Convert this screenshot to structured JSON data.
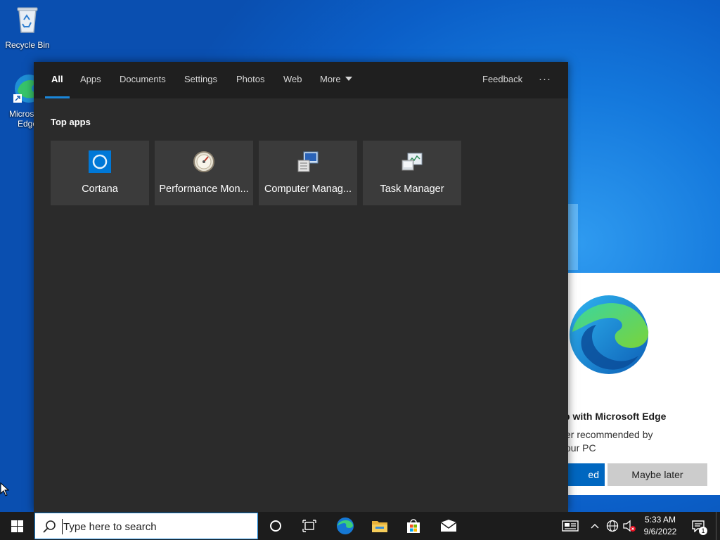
{
  "desktop": {
    "recycle_bin_label": "Recycle Bin",
    "edge_label_line1": "Micros",
    "edge_label_line2": "Edge"
  },
  "search_panel": {
    "tabs": [
      {
        "label": "All",
        "active": true
      },
      {
        "label": "Apps"
      },
      {
        "label": "Documents"
      },
      {
        "label": "Settings"
      },
      {
        "label": "Photos"
      },
      {
        "label": "Web"
      },
      {
        "label": "More"
      }
    ],
    "feedback_label": "Feedback",
    "more_options_label": "···",
    "section_title": "Top apps",
    "top_apps": [
      {
        "label": "Cortana",
        "icon": "cortana-icon"
      },
      {
        "label": "Performance Mon...",
        "icon": "performance-monitor-icon"
      },
      {
        "label": "Computer Manag...",
        "icon": "computer-management-icon"
      },
      {
        "label": "Task Manager",
        "icon": "task-manager-icon"
      }
    ]
  },
  "edge_promo": {
    "title": "b with Microsoft Edge",
    "desc_line1": "er recommended by",
    "desc_line2": "our PC",
    "primary_label": "ed",
    "secondary_label": "Maybe later"
  },
  "taskbar": {
    "search_placeholder": "Type here to search",
    "time": "5:33 AM",
    "date": "9/6/2022",
    "notification_count": "1"
  },
  "colors": {
    "accent": "#1a86d9",
    "panel_bg": "#2b2b2b",
    "tile_bg": "#3b3b3b",
    "taskbar_bg": "#1c1c1c",
    "primary_button": "#0067c0"
  }
}
